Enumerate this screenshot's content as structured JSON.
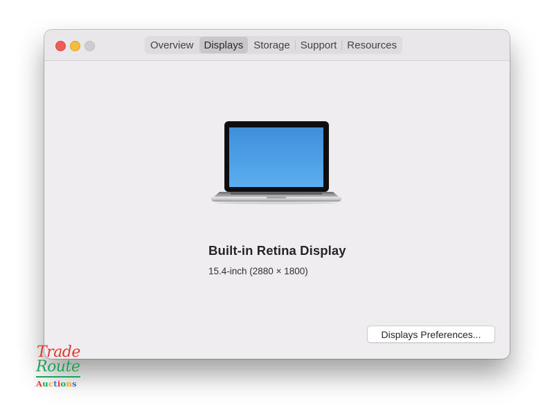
{
  "window": {
    "traffic_lights": {
      "close": "close-button",
      "minimize": "minimize-button",
      "zoom": "zoom-button"
    },
    "tabs": [
      {
        "label": "Overview",
        "active": false
      },
      {
        "label": "Displays",
        "active": true
      },
      {
        "label": "Storage",
        "active": false
      },
      {
        "label": "Support",
        "active": false
      },
      {
        "label": "Resources",
        "active": false
      }
    ]
  },
  "display": {
    "icon": "macbook-pro-laptop-icon",
    "name": "Built-in Retina Display",
    "spec": "15.4-inch (2880 × 1800)"
  },
  "actions": {
    "preferences_button": "Displays Preferences..."
  },
  "watermark": {
    "line1": "Trade",
    "line2": "Route",
    "line3": "Auctions",
    "colors": {
      "line1": "#e2382f",
      "line2": "#1ea256",
      "line3": [
        "#e2382f",
        "#1ea256",
        "#f2a51f",
        "#2f6fd0",
        "#e2382f",
        "#1ea256",
        "#f2a51f",
        "#2f6fd0"
      ]
    }
  },
  "colors": {
    "window_bg": "#efedf0",
    "titlebar_bg": "#e9e7ea",
    "close": "#ee5e57",
    "minimize": "#f5bd3b",
    "zoom_inactive": "#cfcdd0",
    "screen_blue": "#4a9ee6"
  }
}
